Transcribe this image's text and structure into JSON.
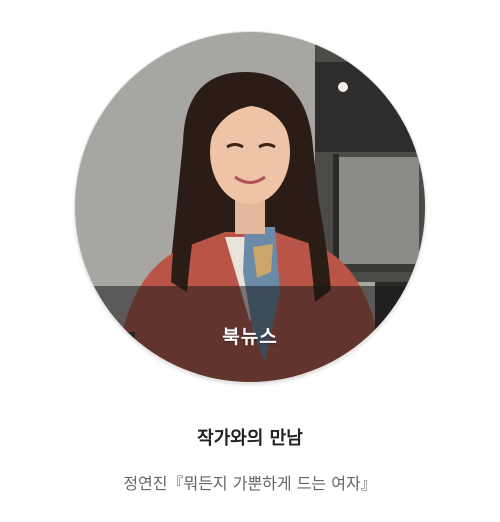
{
  "card": {
    "badge": "북뉴스",
    "title": "작가와의 만남",
    "subtitle": "정연진『뭐든지 가뿐하게 드는 여자』"
  },
  "colors": {
    "title": "#222222",
    "subtitle": "#666666",
    "badge_text": "#ffffff",
    "badge_band": "#191919"
  },
  "photo": {
    "subject": "portrait-of-author"
  }
}
